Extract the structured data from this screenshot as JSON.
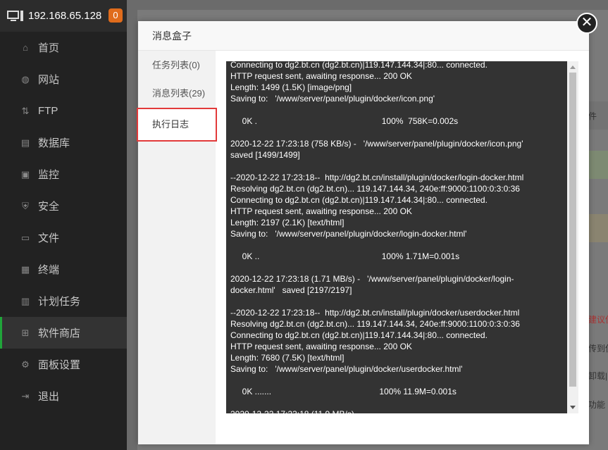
{
  "sidebar": {
    "ip": "192.168.65.128",
    "badge": "0",
    "items": [
      {
        "label": "首页",
        "icon": "home-icon",
        "glyph": "⌂"
      },
      {
        "label": "网站",
        "icon": "globe-icon",
        "glyph": "◍"
      },
      {
        "label": "FTP",
        "icon": "ftp-icon",
        "glyph": "⇅"
      },
      {
        "label": "数据库",
        "icon": "database-icon",
        "glyph": "▤"
      },
      {
        "label": "监控",
        "icon": "monitor-chart-icon",
        "glyph": "▣"
      },
      {
        "label": "安全",
        "icon": "shield-icon",
        "glyph": "⛨"
      },
      {
        "label": "文件",
        "icon": "folder-icon",
        "glyph": "▭"
      },
      {
        "label": "终端",
        "icon": "terminal-icon",
        "glyph": "▦"
      },
      {
        "label": "计划任务",
        "icon": "calendar-icon",
        "glyph": "▥"
      },
      {
        "label": "软件商店",
        "icon": "grid-icon",
        "glyph": "⊞"
      },
      {
        "label": "面板设置",
        "icon": "gear-icon",
        "glyph": "⚙"
      },
      {
        "label": "退出",
        "icon": "logout-icon",
        "glyph": "⇥"
      }
    ]
  },
  "background": {
    "text1": "件",
    "text2": "建议使",
    "text3": "传到使",
    "text4": "卸载|",
    "text5": "功能"
  },
  "modal": {
    "title": "消息盒子",
    "tabs": [
      "任务列表(0)",
      "消息列表(29)",
      "执行日志"
    ],
    "log": "Connecting to dg2.bt.cn (dg2.bt.cn)|119.147.144.34|:80... connected.\nHTTP request sent, awaiting response... 200 OK\nLength: 1499 (1.5K) [image/png]\nSaving to:   '/www/server/panel/plugin/docker/icon.png'\n\n     0K .                                                     100%  758K=0.002s\n\n2020-12-22 17:23:18 (758 KB/s) -   '/www/server/panel/plugin/docker/icon.png'\nsaved [1499/1499]\n\n--2020-12-22 17:23:18--  http://dg2.bt.cn/install/plugin/docker/login-docker.html\nResolving dg2.bt.cn (dg2.bt.cn)... 119.147.144.34, 240e:ff:9000:1100:0:3:0:36\nConnecting to dg2.bt.cn (dg2.bt.cn)|119.147.144.34|:80... connected.\nHTTP request sent, awaiting response... 200 OK\nLength: 2197 (2.1K) [text/html]\nSaving to:   '/www/server/panel/plugin/docker/login-docker.html'\n\n     0K ..                                                    100% 1.71M=0.001s\n\n2020-12-22 17:23:18 (1.71 MB/s) -   '/www/server/panel/plugin/docker/login-\ndocker.html'   saved [2197/2197]\n\n--2020-12-22 17:23:18--  http://dg2.bt.cn/install/plugin/docker/userdocker.html\nResolving dg2.bt.cn (dg2.bt.cn)... 119.147.144.34, 240e:ff:9000:1100:0:3:0:36\nConnecting to dg2.bt.cn (dg2.bt.cn)|119.147.144.34|:80... connected.\nHTTP request sent, awaiting response... 200 OK\nLength: 7680 (7.5K) [text/html]\nSaving to:   '/www/server/panel/plugin/docker/userdocker.html'\n\n     0K .......                                              100% 11.9M=0.001s\n\n2020-12-22 17:23:18 (11.9 MB/s) -",
    "close_glyph": "✕"
  }
}
